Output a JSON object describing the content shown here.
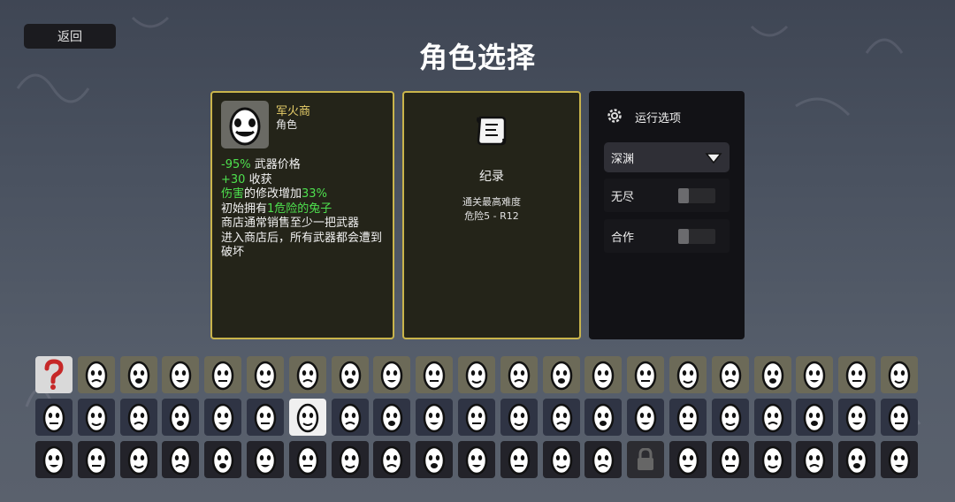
{
  "header": {
    "back_label": "返回",
    "title": "角色选择"
  },
  "character": {
    "name": "军火商",
    "type": "角色",
    "stats": [
      {
        "value": "-95%",
        "text": " 武器价格"
      },
      {
        "value": "+30",
        "text": " 收获"
      },
      {
        "green1": "伤害",
        "mid": "的修改增加",
        "green2": "33%"
      },
      {
        "pre": "初始拥有",
        "green": "1危险的兔子"
      },
      {
        "text": "商店通常销售至少一把武器"
      },
      {
        "text": "进入商店后，所有武器都会遭到破坏"
      }
    ]
  },
  "record": {
    "title": "纪录",
    "line1": "通关最高难度",
    "line2": "危险5 - R12"
  },
  "options": {
    "title": "运行选项",
    "difficulty_selected": "深渊",
    "endless_label": "无尽",
    "coop_label": "合作",
    "endless_enabled": false,
    "coop_enabled": false
  },
  "grid": {
    "rows": 3,
    "cols": 21,
    "selected": {
      "row": 1,
      "col": 6
    },
    "random_icon": "question-icon",
    "locked_icon": "padlock-icon"
  }
}
